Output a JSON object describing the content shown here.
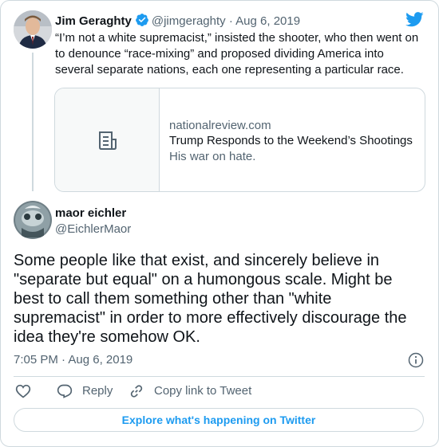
{
  "parent_tweet": {
    "author_name": "Jim Geraghty",
    "handle": "@jimgeraghty",
    "separator": "·",
    "date": "Aug 6, 2019",
    "text": "“I’m not a white supremacist,” insisted the shooter, who then went on to denounce “race-mixing” and proposed dividing America into several separate nations, each one representing a particular race.",
    "link_card": {
      "domain": "nationalreview.com",
      "title": "Trump Responds to the Weekend’s Shootings",
      "description": "His war on hate."
    }
  },
  "main_tweet": {
    "author_name": "maor eichler",
    "handle": "@EichlerMaor",
    "text": "Some people like that exist, and sincerely believe in \"separate but equal\" on a humongous scale. Might be best to call them something other than \"white supremacist\" in order to more effectively discourage the idea they're somehow OK.",
    "timestamp": "7:05 PM · Aug 6, 2019"
  },
  "actions": {
    "like_icon": "heart-icon",
    "reply_label": "Reply",
    "copy_link_label": "Copy link to Tweet"
  },
  "explore_button": "Explore what's happening on Twitter",
  "colors": {
    "accent": "#1d9bf0",
    "verified": "#1d9bf0",
    "secondary_text": "#536471",
    "border": "#cfd9de"
  }
}
